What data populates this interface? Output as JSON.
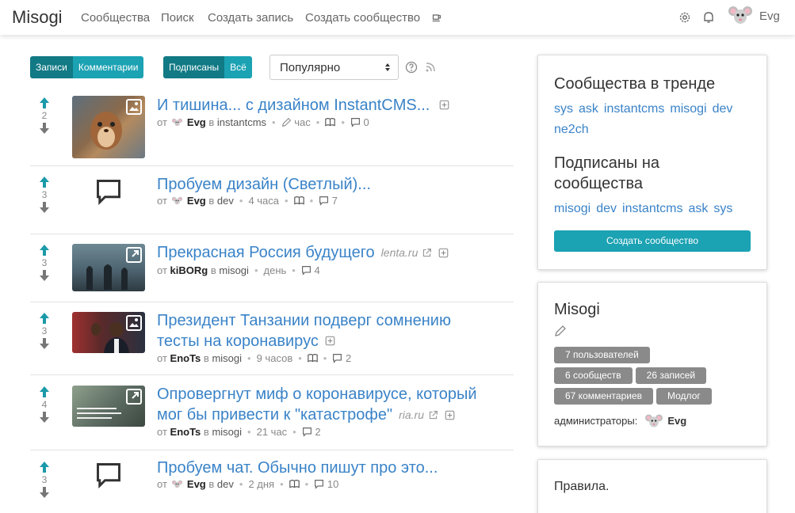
{
  "nav": {
    "brand": "Misogi",
    "links": [
      "Сообщества",
      "Поиск",
      "Создать запись",
      "Создать сообщество"
    ],
    "user": "Evg",
    "icons": [
      "coffee-icon",
      "gear-icon",
      "bell-icon"
    ]
  },
  "toolbar": {
    "tab_posts": "Записи",
    "tab_comments": "Комментарии",
    "filter_subscribed": "Подписаны",
    "filter_all": "Всё",
    "sort_value": "Популярно"
  },
  "posts": [
    {
      "score": "2",
      "title": "И тишина... с дизайном InstantCMS...",
      "from": "от",
      "author": "Evg",
      "in": "в",
      "community": "instantcms",
      "time": "час",
      "comments": "0"
    },
    {
      "score": "3",
      "title": "Пробуем дизайн (Светлый)...",
      "from": "от",
      "author": "Evg",
      "in": "в",
      "community": "dev",
      "time": "4 часа",
      "comments": "7"
    },
    {
      "score": "3",
      "title": "Прекрасная Россия будущего",
      "source": "lenta.ru",
      "from": "от",
      "author": "kiBORg",
      "in": "в",
      "community": "misogi",
      "time": "день",
      "comments": "4"
    },
    {
      "score": "3",
      "title_l1": "Президент Танзании подверг сомнению",
      "title_l2": "тесты на коронавирус",
      "from": "от",
      "author": "EnoTs",
      "in": "в",
      "community": "misogi",
      "time": "9 часов",
      "comments": "2"
    },
    {
      "score": "4",
      "title_l1": "Опровергнут миф о коронавирусе, который",
      "title_l2": "мог бы привести к \"катастрофе\"",
      "source": "ria.ru",
      "from": "от",
      "author": "EnoTs",
      "in": "в",
      "community": "misogi",
      "time": "21 час",
      "comments": "2"
    },
    {
      "score": "3",
      "title": "Пробуем чат. Обычно пишут про это...",
      "from": "от",
      "author": "Evg",
      "in": "в",
      "community": "dev",
      "time": "2 дня",
      "comments": "10"
    }
  ],
  "sidebar": {
    "trending_title": "Сообщества в тренде",
    "trending": [
      "sys",
      "ask",
      "instantcms",
      "misogi",
      "dev",
      "ne2ch"
    ],
    "subscribed_title_l1": "Подписаны на",
    "subscribed_title_l2": "сообщества",
    "subscribed": [
      "misogi",
      "dev",
      "instantcms",
      "ask",
      "sys"
    ],
    "create_button": "Создать сообщество",
    "site_title": "Misogi",
    "stats": [
      "7 пользователей",
      "6 сообществ",
      "26 записей",
      "67 комментариев",
      "Модлог"
    ],
    "admins_label": "администраторы:",
    "admin_name": "Evg",
    "rules": "Правила."
  },
  "colors": {
    "accent": "#1ba2b3",
    "accent_dark": "#117a85",
    "link": "#3a83c8"
  }
}
